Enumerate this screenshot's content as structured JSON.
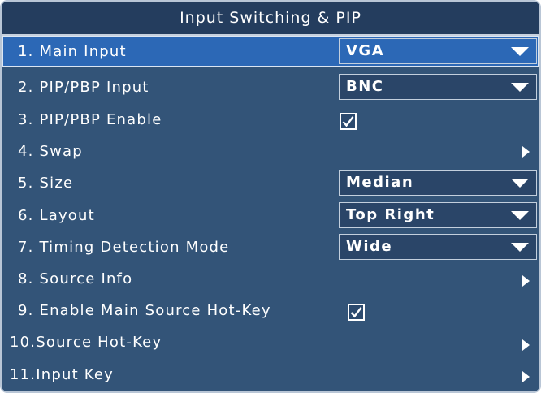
{
  "title": "Input Switching & PIP",
  "menu": {
    "items": [
      {
        "label": "1. Main Input",
        "value": "VGA"
      },
      {
        "label": "2. PIP/PBP Input",
        "value": "BNC"
      },
      {
        "label": "3. PIP/PBP Enable"
      },
      {
        "label": "4. Swap"
      },
      {
        "label": "5. Size",
        "value": "Median"
      },
      {
        "label": "6. Layout",
        "value": "Top Right"
      },
      {
        "label": "7. Timing Detection Mode",
        "value": "Wide"
      },
      {
        "label": "8. Source Info"
      },
      {
        "label": "9. Enable Main Source Hot-Key"
      },
      {
        "label": "10.Source Hot-Key"
      },
      {
        "label": "11.Input Key"
      }
    ]
  },
  "states": {
    "selected_index": 0,
    "pip_pbp_enable_checked": true,
    "hotkey_enable_checked": true
  },
  "icons": {
    "dropdown": "triangle-down-icon",
    "submenu": "triangle-right-icon",
    "check": "checkmark-icon"
  },
  "colors": {
    "panel_bg": "#335478",
    "title_bg": "#243d5e",
    "selection": "#2c68b6",
    "text": "#ffffff"
  }
}
